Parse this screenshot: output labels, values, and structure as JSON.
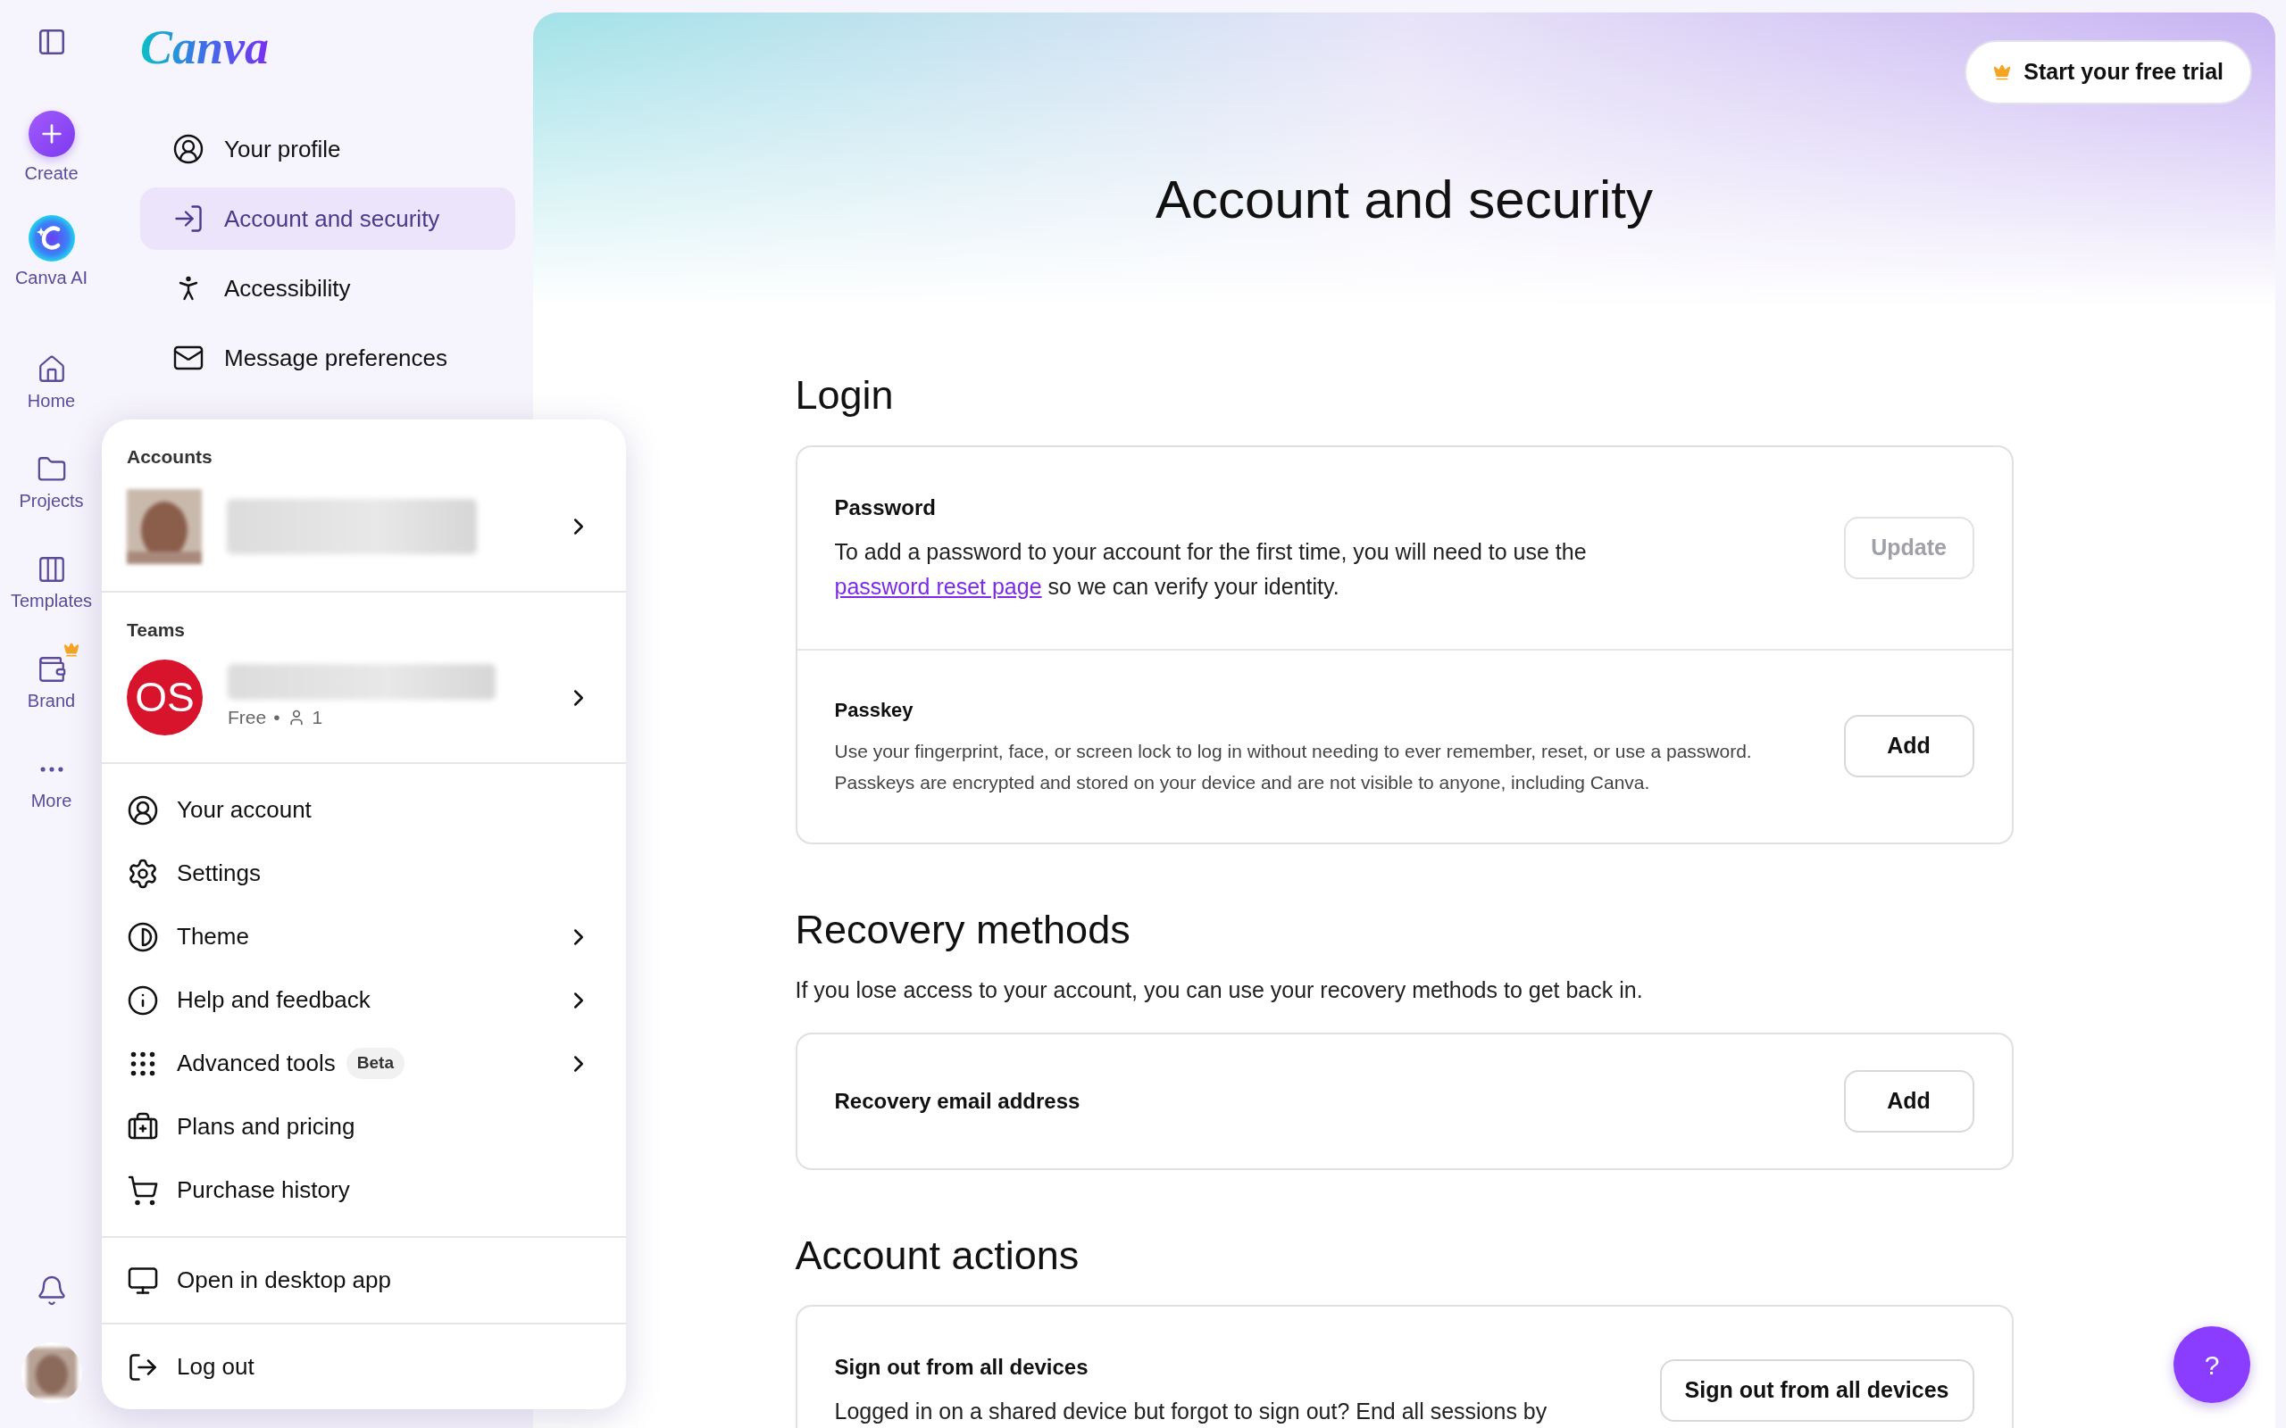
{
  "rail": {
    "items": [
      {
        "label": "Create",
        "kind": "create",
        "premium": false
      },
      {
        "label": "Canva AI",
        "kind": "ai",
        "premium": false
      },
      {
        "label": "Home",
        "kind": "home",
        "premium": false
      },
      {
        "label": "Projects",
        "kind": "projects",
        "premium": false
      },
      {
        "label": "Templates",
        "kind": "templates",
        "premium": false
      },
      {
        "label": "Brand",
        "kind": "brand",
        "premium": true
      },
      {
        "label": "More",
        "kind": "more",
        "premium": false
      }
    ]
  },
  "sidebar": {
    "logo": "Canva",
    "items": [
      {
        "label": "Your profile",
        "kind": "profile",
        "selected": false
      },
      {
        "label": "Account and security",
        "kind": "security",
        "selected": true
      },
      {
        "label": "Accessibility",
        "kind": "accessibility",
        "selected": false
      },
      {
        "label": "Message preferences",
        "kind": "messages",
        "selected": false
      }
    ]
  },
  "account_menu": {
    "accounts_heading": "Accounts",
    "teams_heading": "Teams",
    "team": {
      "initials": "OS",
      "plan": "Free",
      "separator": "•",
      "members": "1"
    },
    "groups": [
      [
        {
          "label": "Your account",
          "kind": "account",
          "submenu": false
        },
        {
          "label": "Settings",
          "kind": "settings",
          "submenu": false
        },
        {
          "label": "Theme",
          "kind": "theme",
          "submenu": true
        },
        {
          "label": "Help and feedback",
          "kind": "help",
          "submenu": true
        },
        {
          "label": "Advanced tools",
          "kind": "tools",
          "submenu": true,
          "badge": "Beta"
        },
        {
          "label": "Plans and pricing",
          "kind": "plans",
          "submenu": false
        },
        {
          "label": "Purchase history",
          "kind": "purchases",
          "submenu": false
        }
      ],
      [
        {
          "label": "Open in desktop app",
          "kind": "desktop",
          "submenu": false
        }
      ],
      [
        {
          "label": "Log out",
          "kind": "logout",
          "submenu": false
        }
      ]
    ]
  },
  "main": {
    "trial_button": "Start your free trial",
    "title": "Account and security",
    "sections": [
      {
        "heading": "Login",
        "rows": [
          {
            "title": "Password",
            "text_before": "To add a password to your account for the first time, you will need to use the ",
            "link": "password reset page",
            "text_after": " so we can verify your identity.",
            "small": false,
            "button": "Update",
            "disabled": true
          },
          {
            "title": "Passkey",
            "text_before": "Use your fingerprint, face, or screen lock to log in without needing to ever remember, reset, or use a password. Passkeys are encrypted and stored on your device and are not visible to anyone, including Canva.",
            "small": true,
            "button": "Add",
            "disabled": false
          }
        ]
      },
      {
        "heading": "Recovery methods",
        "description": "If you lose access to your account, you can use your recovery methods to get back in.",
        "rows": [
          {
            "title": "Recovery email address",
            "small": false,
            "button": "Add",
            "disabled": false
          }
        ]
      },
      {
        "heading": "Account actions",
        "rows": [
          {
            "title": "Sign out from all devices",
            "text_before": "Logged in on a shared device but forgot to sign out? End all sessions by",
            "small": false,
            "button": "Sign out from all devices",
            "disabled": false
          }
        ]
      }
    ]
  },
  "help_button": "?"
}
